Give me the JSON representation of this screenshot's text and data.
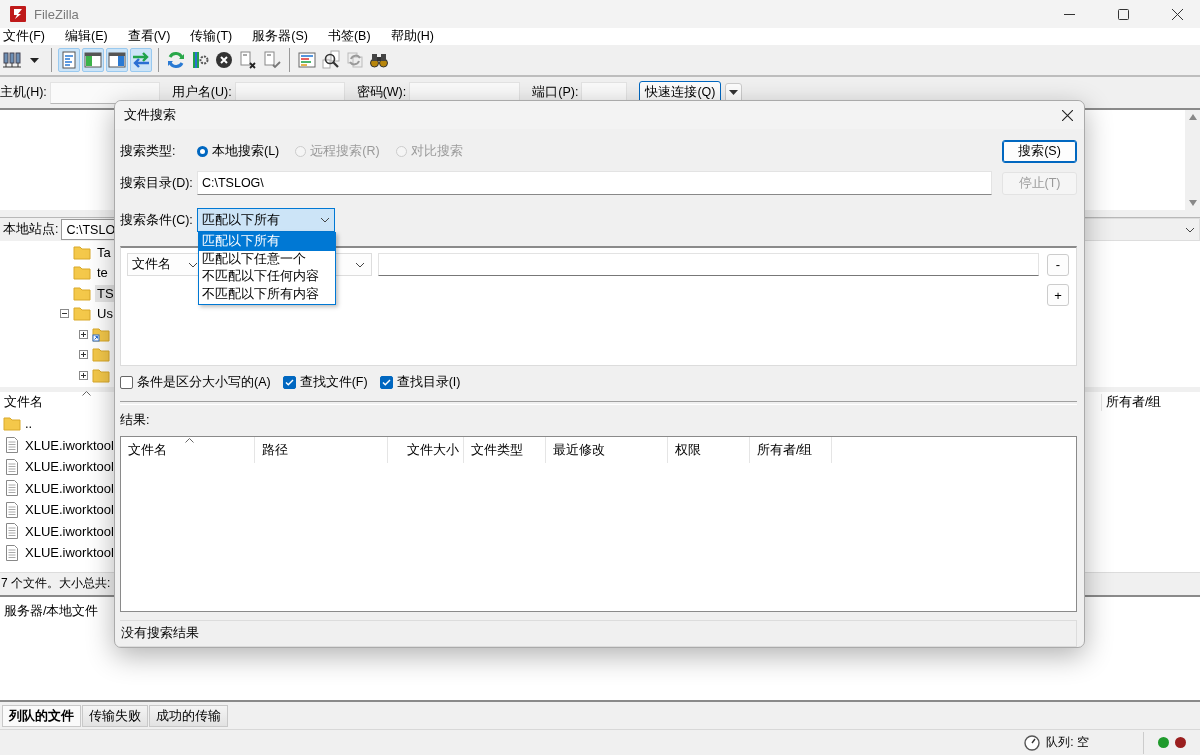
{
  "window": {
    "title": "FileZilla"
  },
  "menu": [
    "文件(F)",
    "编辑(E)",
    "查看(V)",
    "传输(T)",
    "服务器(S)",
    "书签(B)",
    "帮助(H)"
  ],
  "toolbar": [
    [
      {
        "kind": "site_manager",
        "on": false
      }
    ],
    [
      {
        "kind": "log_toggle",
        "on": true
      },
      {
        "kind": "local_tree_toggle",
        "on": true
      },
      {
        "kind": "remote_tree_toggle",
        "on": true
      },
      {
        "kind": "queue_toggle",
        "on": true
      }
    ],
    [
      {
        "kind": "refresh",
        "on": false
      },
      {
        "kind": "process_queue",
        "on": false
      },
      {
        "kind": "cancel",
        "on": false
      },
      {
        "kind": "disconnect",
        "on": false
      },
      {
        "kind": "reconnect",
        "on": false
      }
    ],
    [
      {
        "kind": "filter",
        "on": false
      },
      {
        "kind": "compare",
        "on": false
      },
      {
        "kind": "sync_browse",
        "on": false
      },
      {
        "kind": "find",
        "on": false
      }
    ]
  ],
  "quickconnect": {
    "fields": [
      {
        "label": "主机(H):"
      },
      {
        "label": "用户名(U):"
      },
      {
        "label": "密码(W):"
      },
      {
        "label": "端口(P):"
      }
    ],
    "button": "快速连接(Q)"
  },
  "local": {
    "site_label": "本地站点:",
    "path": "C:\\TSLO",
    "tree": [
      {
        "name": "Ta",
        "selected": false
      },
      {
        "name": "te",
        "selected": false
      },
      {
        "name": "TS",
        "selected": true
      },
      {
        "name": "Us",
        "selected": false,
        "expanded": true,
        "children": [
          {
            "kind": "shortcut",
            "expanded": false
          },
          {
            "kind": "folder",
            "expanded": false
          },
          {
            "kind": "folder",
            "expanded": false
          }
        ]
      }
    ],
    "columns": [
      "文件名"
    ],
    "files": [
      {
        "kind": "folder",
        "name": ".."
      },
      {
        "kind": "file",
        "name": "XLUE.iworktool"
      },
      {
        "kind": "file",
        "name": "XLUE.iworktool"
      },
      {
        "kind": "file",
        "name": "XLUE.iworktool"
      },
      {
        "kind": "file",
        "name": "XLUE.iworktool"
      },
      {
        "kind": "file",
        "name": "XLUE.iworktool"
      },
      {
        "kind": "file",
        "name": "XLUE.iworktool"
      }
    ],
    "status": "7 个文件。大小总共:"
  },
  "remote": {
    "columns": [
      "所有者/组"
    ]
  },
  "queue": {
    "columns": [
      "服务器/本地文件"
    ],
    "tabs": [
      {
        "label": "列队的文件",
        "selected": true
      },
      {
        "label": "传输失败",
        "selected": false
      },
      {
        "label": "成功的传输",
        "selected": false
      }
    ]
  },
  "status_bar": {
    "queue": "队列: 空",
    "lights": [
      {
        "color": "#1f9a2c"
      },
      {
        "color": "#9a1f1f"
      }
    ]
  },
  "dialog": {
    "title": "文件搜索",
    "search_type": {
      "label": "搜索类型:",
      "options": [
        {
          "label": "本地搜索(L)",
          "selected": true,
          "disabled": false
        },
        {
          "label": "远程搜索(R)",
          "selected": false,
          "disabled": true
        },
        {
          "label": "对比搜索",
          "selected": false,
          "disabled": true
        }
      ]
    },
    "directory": {
      "label": "搜索目录(D):",
      "value": "C:\\TSLOG\\"
    },
    "buttons": [
      {
        "label": "搜索(S)",
        "disabled": false
      },
      {
        "label": "停止(T)",
        "disabled": true
      }
    ],
    "conditions": {
      "label": "搜索条件(C):",
      "value": "匹配以下所有",
      "expanded": true,
      "options": [
        {
          "label": "匹配以下所有",
          "selected": true
        },
        {
          "label": "匹配以下任意一个",
          "selected": false
        },
        {
          "label": "不匹配以下任何内容",
          "selected": false
        },
        {
          "label": "不匹配以下所有内容",
          "selected": false
        }
      ]
    },
    "rows": [
      {
        "field": "文件名"
      }
    ],
    "row_buttons": [
      "-",
      "+"
    ],
    "checkboxes": [
      {
        "label": "条件是区分大小写的(A)",
        "checked": false
      },
      {
        "label": "查找文件(F)",
        "checked": true
      },
      {
        "label": "查找目录(I)",
        "checked": true
      }
    ],
    "results_label": "结果:",
    "columns": [
      "文件名",
      "路径",
      "文件大小",
      "文件类型",
      "最近修改",
      "权限",
      "所有者/组"
    ],
    "status": "没有搜索结果"
  }
}
